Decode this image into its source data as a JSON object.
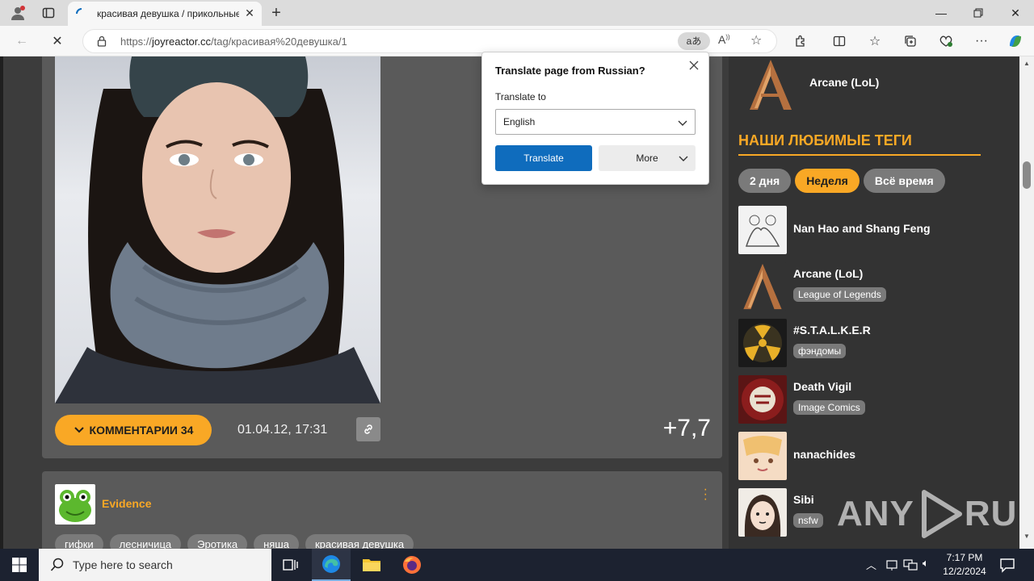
{
  "browser": {
    "tab_title": "красивая девушка / прикольные",
    "url_prefix": "https://",
    "url_host": "joyreactor.cc",
    "url_path": "/tag/красивая%20девушка/1",
    "translate_badge": "aあ"
  },
  "translate_popup": {
    "title": "Translate page from Russian?",
    "label": "Translate to",
    "selected_language": "English",
    "translate_button": "Translate",
    "more_button": "More"
  },
  "post1": {
    "comments_button": "КОММЕНТАРИИ 34",
    "date": "01.04.12, 17:31",
    "rating": "+7,7"
  },
  "post2": {
    "author": "Evidence",
    "tags": [
      "гифки",
      "лесничица",
      "Эротика",
      "няша",
      "красивая девушка"
    ]
  },
  "sidebar": {
    "top_item": "Arcane (LoL)",
    "section_title": "НАШИ ЛЮБИМЫЕ ТЕГИ",
    "periods": [
      "2 дня",
      "Неделя",
      "Всё время"
    ],
    "active_period": "Неделя",
    "favorites": [
      {
        "name": "Nan Hao and Shang Feng",
        "badge": ""
      },
      {
        "name": "Arcane (LoL)",
        "badge": "League of Legends"
      },
      {
        "name": "#S.T.A.L.K.E.R",
        "badge": "фэндомы"
      },
      {
        "name": "Death Vigil",
        "badge": "Image Comics"
      },
      {
        "name": "nanachides",
        "badge": ""
      },
      {
        "name": "Sibi",
        "badge": "nsfw"
      }
    ]
  },
  "watermark": {
    "left": "ANY",
    "right": "RUN"
  },
  "taskbar": {
    "search_placeholder": "Type here to search",
    "time": "7:17 PM",
    "date": "12/2/2024"
  },
  "colors": {
    "accent": "#f9a825",
    "edge_blue": "#0f6cbd"
  }
}
